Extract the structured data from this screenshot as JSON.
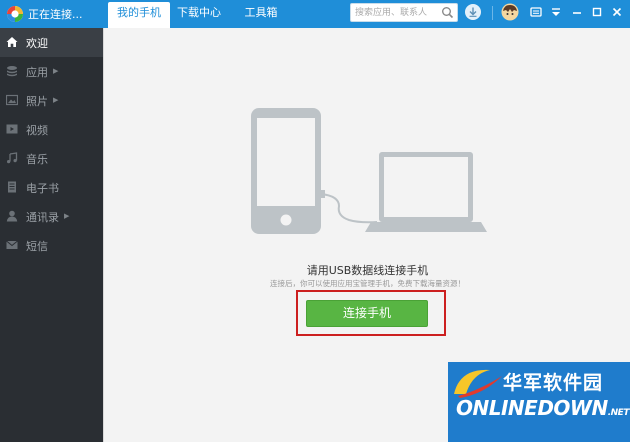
{
  "app": {
    "status": "正在连接..."
  },
  "tabs": [
    {
      "label": "我的手机",
      "active": true
    },
    {
      "label": "下载中心",
      "active": false
    },
    {
      "label": "工具箱",
      "active": false
    }
  ],
  "search": {
    "placeholder": "搜索应用、联系人",
    "icon": "search-icon"
  },
  "titlebar_icons": [
    "download-icon",
    "avatar",
    "message-icon",
    "dropdown-menu-icon",
    "minimize-icon",
    "maximize-icon",
    "close-icon"
  ],
  "sidebar": {
    "items": [
      {
        "label": "欢迎",
        "icon": "home-icon",
        "active": true,
        "has_submenu": false
      },
      {
        "label": "应用",
        "icon": "apps-icon",
        "active": false,
        "has_submenu": true
      },
      {
        "label": "照片",
        "icon": "photo-icon",
        "active": false,
        "has_submenu": true
      },
      {
        "label": "视频",
        "icon": "video-icon",
        "active": false,
        "has_submenu": false
      },
      {
        "label": "音乐",
        "icon": "music-icon",
        "active": false,
        "has_submenu": false
      },
      {
        "label": "电子书",
        "icon": "ebook-icon",
        "active": false,
        "has_submenu": false
      },
      {
        "label": "通讯录",
        "icon": "contacts-icon",
        "active": false,
        "has_submenu": true
      },
      {
        "label": "短信",
        "icon": "sms-icon",
        "active": false,
        "has_submenu": false
      }
    ]
  },
  "main": {
    "prompt_title": "请用USB数据线连接手机",
    "prompt_sub": "连接后，你可以使用应用宝管理手机，免费下载海量资源！",
    "connect_button": "连接手机"
  },
  "watermark": {
    "cn": "华军软件园",
    "en": "ONLINEDOWN",
    "net": ".NET"
  },
  "colors": {
    "titlebar": "#1f8ed8",
    "sidebar": "#2a2e33",
    "sidebar_active": "#3a3f45",
    "main_bg": "#f3f3f3",
    "connect_button": "#58b543",
    "highlight": "#cc1f1f",
    "watermark": "#1f7ccc"
  }
}
